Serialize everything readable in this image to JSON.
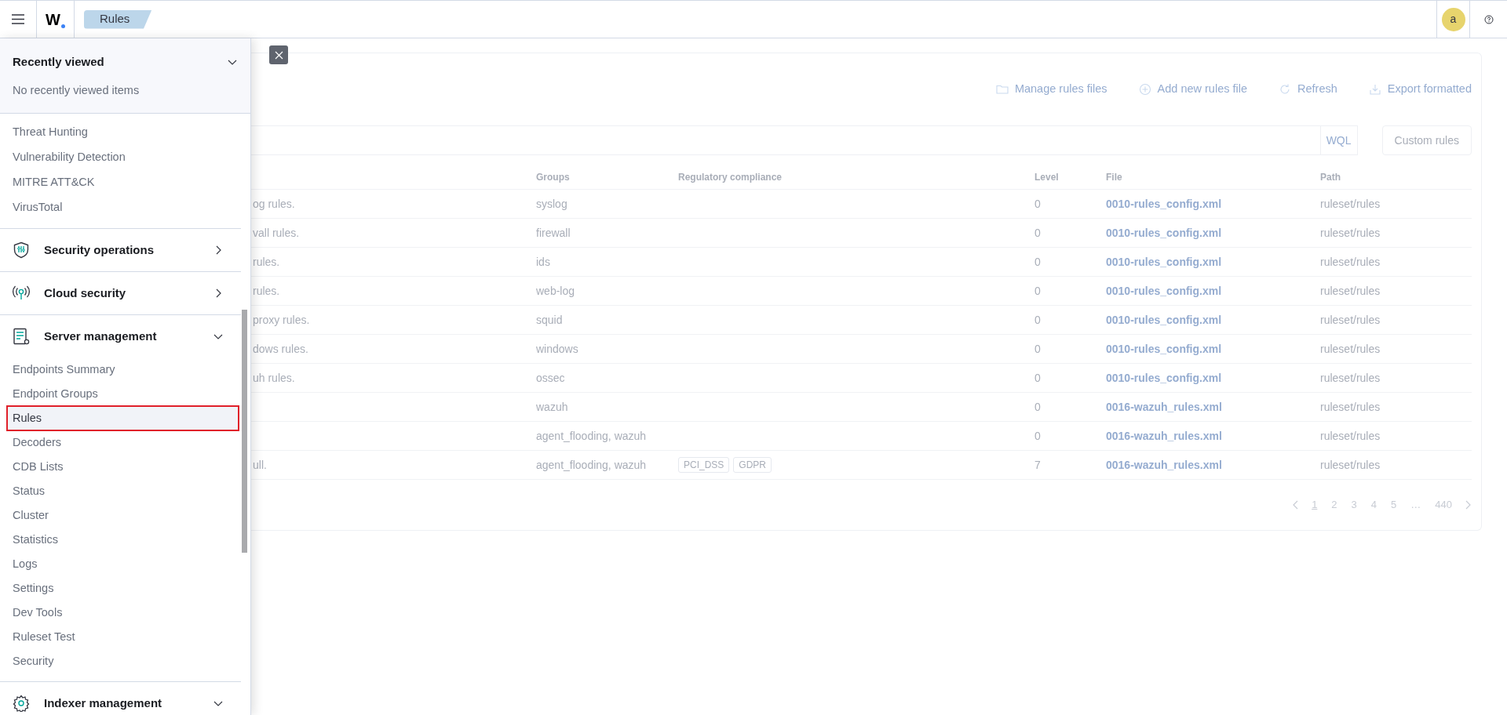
{
  "header": {
    "logo": "W",
    "breadcrumb": "Rules",
    "avatar": "a"
  },
  "sidebar": {
    "recently_viewed": {
      "title": "Recently viewed",
      "expanded": true,
      "empty_text": "No recently viewed items"
    },
    "items": [
      "Threat Hunting",
      "Vulnerability Detection",
      "MITRE ATT&CK",
      "VirusTotal"
    ],
    "sections": [
      {
        "kind": "shield",
        "title": "Security operations",
        "expanded": false
      },
      {
        "kind": "antenna",
        "title": "Cloud security",
        "expanded": false
      },
      {
        "kind": "server",
        "title": "Server management",
        "expanded": true,
        "children": [
          {
            "label": "Endpoints Summary",
            "selected": false
          },
          {
            "label": "Endpoint Groups",
            "selected": false
          },
          {
            "label": "Rules",
            "selected": true
          },
          {
            "label": "Decoders",
            "selected": false
          },
          {
            "label": "CDB Lists",
            "selected": false
          },
          {
            "label": "Status",
            "selected": false
          },
          {
            "label": "Cluster",
            "selected": false
          },
          {
            "label": "Statistics",
            "selected": false
          },
          {
            "label": "Logs",
            "selected": false
          },
          {
            "label": "Settings",
            "selected": false
          },
          {
            "label": "Dev Tools",
            "selected": false
          },
          {
            "label": "Ruleset Test",
            "selected": false
          },
          {
            "label": "Security",
            "selected": false
          }
        ]
      },
      {
        "kind": "gear",
        "title": "Indexer management",
        "expanded": true
      }
    ]
  },
  "main": {
    "actions": [
      {
        "kind": "folder",
        "label": "Manage rules files"
      },
      {
        "kind": "plus",
        "label": "Add new rules file"
      },
      {
        "kind": "refresh",
        "label": "Refresh"
      },
      {
        "kind": "export",
        "label": "Export formatted"
      }
    ],
    "search": {
      "query_language": "WQL"
    },
    "custom_rules_button": "Custom rules",
    "table": {
      "columns": [
        "Groups",
        "Regulatory compliance",
        "Level",
        "File",
        "Path"
      ],
      "rows": [
        {
          "column_1": "og rules.",
          "groups": "syslog",
          "compliance": [],
          "level": "0",
          "file": "0010-rules_config.xml",
          "path": "ruleset/rules"
        },
        {
          "column_1": "vall rules.",
          "groups": "firewall",
          "compliance": [],
          "level": "0",
          "file": "0010-rules_config.xml",
          "path": "ruleset/rules"
        },
        {
          "column_1": "rules.",
          "groups": "ids",
          "compliance": [],
          "level": "0",
          "file": "0010-rules_config.xml",
          "path": "ruleset/rules"
        },
        {
          "column_1": "rules.",
          "groups": "web-log",
          "compliance": [],
          "level": "0",
          "file": "0010-rules_config.xml",
          "path": "ruleset/rules"
        },
        {
          "column_1": "proxy rules.",
          "groups": "squid",
          "compliance": [],
          "level": "0",
          "file": "0010-rules_config.xml",
          "path": "ruleset/rules"
        },
        {
          "column_1": "dows rules.",
          "groups": "windows",
          "compliance": [],
          "level": "0",
          "file": "0010-rules_config.xml",
          "path": "ruleset/rules"
        },
        {
          "column_1": "uh rules.",
          "groups": "ossec",
          "compliance": [],
          "level": "0",
          "file": "0010-rules_config.xml",
          "path": "ruleset/rules"
        },
        {
          "groups": "wazuh",
          "compliance": [],
          "level": "0",
          "file": "0016-wazuh_rules.xml",
          "path": "ruleset/rules"
        },
        {
          "groups": "agent_flooding, wazuh",
          "compliance": [],
          "level": "0",
          "file": "0016-wazuh_rules.xml",
          "path": "ruleset/rules"
        },
        {
          "column_1": "ull.",
          "groups": "agent_flooding, wazuh",
          "compliance": [
            "PCI_DSS",
            "GDPR"
          ],
          "level": "7",
          "file": "0016-wazuh_rules.xml",
          "path": "ruleset/rules"
        }
      ]
    },
    "pagination": [
      {
        "label": "1",
        "selected": true
      },
      {
        "label": "2",
        "selected": false
      },
      {
        "label": "3",
        "selected": false
      },
      {
        "label": "4",
        "selected": false
      },
      {
        "label": "5",
        "selected": false
      },
      {
        "label": "…",
        "selected": false
      },
      {
        "label": "440",
        "selected": false
      }
    ]
  }
}
